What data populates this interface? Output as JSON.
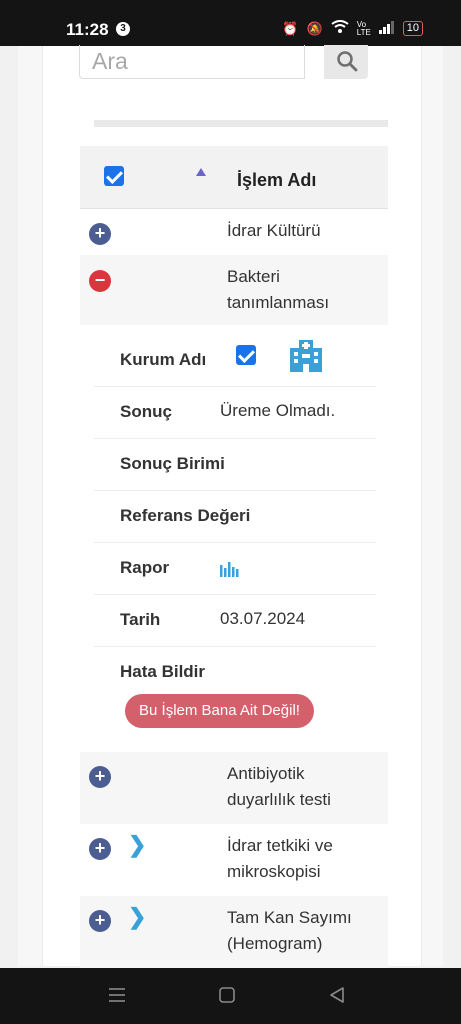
{
  "status_bar": {
    "time": "11:28",
    "notification_count": "3",
    "battery": "10",
    "network": "Vo LTE"
  },
  "search": {
    "placeholder": "Ara"
  },
  "table": {
    "header": {
      "column_label": "İşlem Adı"
    },
    "rows": [
      {
        "label": "İdrar Kültürü"
      },
      {
        "label": "Bakteri tanımlanması"
      },
      {
        "label": "Antibiyotik duyarlılık testi"
      },
      {
        "label": "İdrar tetkiki ve mikroskopisi"
      },
      {
        "label": "Tam Kan Sayımı (Hemogram)"
      }
    ]
  },
  "details": {
    "kurum_adi_label": "Kurum Adı",
    "sonuc_label": "Sonuç",
    "sonuc_value": "Üreme Olmadı.",
    "sonuc_birimi_label": "Sonuç Birimi",
    "referans_label": "Referans Değeri",
    "rapor_label": "Rapor",
    "tarih_label": "Tarih",
    "tarih_value": "03.07.2024",
    "hata_label": "Hata Bildir",
    "hata_button": "Bu İşlem Bana Ait Değil!"
  },
  "icons": {
    "search": "search-icon",
    "hospital": "hospital-icon",
    "report": "bar-chart-icon",
    "expand": "plus-icon",
    "collapse": "minus-icon",
    "chevron": "chevron-right-icon"
  },
  "colors": {
    "accent": "#1a73e8",
    "plus": "#4c5d92",
    "minus": "#d9363e",
    "error_button": "#d3606b",
    "hospital": "#3aa0d8"
  }
}
